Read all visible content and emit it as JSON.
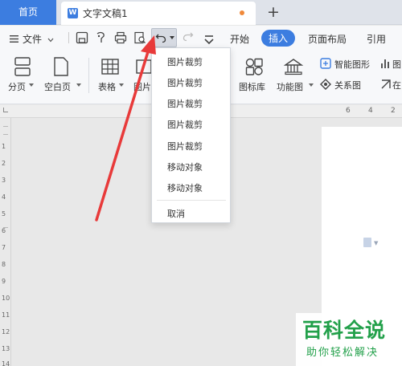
{
  "tabs": {
    "home_label": "首页",
    "document_icon": "W",
    "document_title": "文字文稿1",
    "new_tab_symbol": "+"
  },
  "toolbar": {
    "file_menu_label": "文件",
    "ribbon_tabs": [
      "开始",
      "插入",
      "页面布局",
      "引用"
    ],
    "active_tab": "插入"
  },
  "ribbon": {
    "page_break_label": "分页",
    "blank_page_label": "空白页",
    "table_label": "表格",
    "picture_label": "图片",
    "icon_library_label": "图标库",
    "function_chart_label": "功能图",
    "smart_shape_label": "智能图形",
    "relation_chart_label": "关系图",
    "chart_label": "图",
    "online_label": "在"
  },
  "undo_menu": {
    "items": [
      "图片裁剪",
      "图片裁剪",
      "图片裁剪",
      "图片裁剪",
      "图片裁剪",
      "移动对象",
      "移动对象"
    ],
    "cancel_label": "取消"
  },
  "ruler": {
    "top_numbers": [
      "6",
      "4",
      "2"
    ],
    "left_numbers": [
      "1",
      "2",
      "3",
      "4",
      "5",
      "6",
      "7",
      "8",
      "9",
      "10",
      "11",
      "12",
      "13",
      "14"
    ]
  },
  "watermark": {
    "title": "百科全说",
    "subtitle": "助你轻松解决"
  },
  "colors": {
    "accent": "#3c7de0",
    "annotation_arrow": "#e83a3a",
    "watermark_green": "#22a04a"
  }
}
